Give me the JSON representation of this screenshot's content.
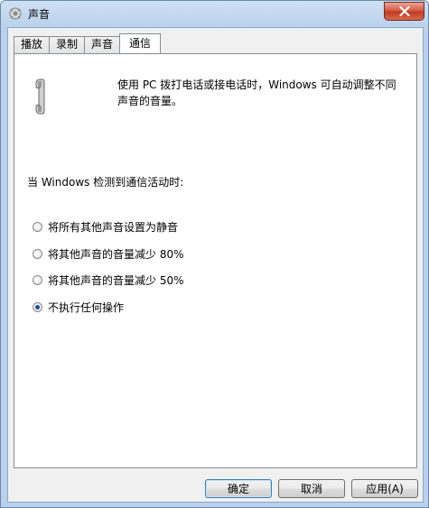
{
  "window": {
    "title": "声音",
    "icon": "speaker-icon",
    "close_icon": "close-icon"
  },
  "tabs": [
    {
      "label": "播放",
      "active": false
    },
    {
      "label": "录制",
      "active": false
    },
    {
      "label": "声音",
      "active": false
    },
    {
      "label": "通信",
      "active": true
    }
  ],
  "communications": {
    "icon": "telephone-handset-icon",
    "description_line1": "使用 PC 拨打电话或接电话时，Windows 可自动调整不同",
    "description_line2": "声音的音量。",
    "section_label": "当 Windows 检测到通信活动时:",
    "options": [
      {
        "label": "将所有其他声音设置为静音",
        "checked": false
      },
      {
        "label": "将其他声音的音量减少 80%",
        "checked": false
      },
      {
        "label": "将其他声音的音量减少 50%",
        "checked": false
      },
      {
        "label": "不执行任何操作",
        "checked": true
      }
    ]
  },
  "buttons": {
    "ok": "确定",
    "cancel": "取消",
    "apply": "应用(A)"
  },
  "colors": {
    "accent": "#1d4ea6",
    "close_button": "#c0391f",
    "frame": "#b9d1ec"
  }
}
